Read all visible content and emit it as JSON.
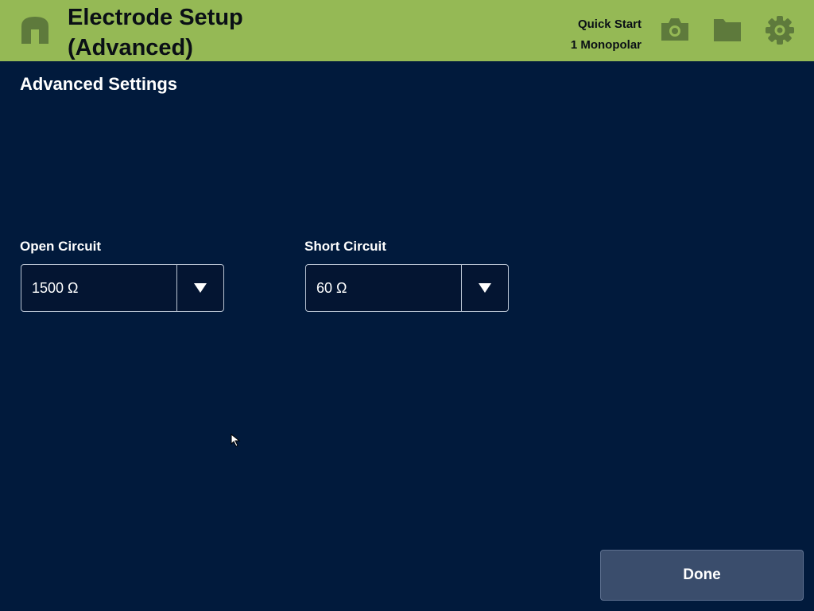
{
  "header": {
    "title_line1": "Electrode Setup",
    "title_line2": "(Advanced)",
    "preset_name": "Quick Start",
    "preset_mode": "1 Monopolar",
    "icons": [
      "home-icon",
      "camera-icon",
      "folder-icon",
      "gear-icon"
    ]
  },
  "main": {
    "section_title": "Advanced Settings",
    "open_circuit": {
      "label": "Open Circuit",
      "value": "1500 Ω"
    },
    "short_circuit": {
      "label": "Short Circuit",
      "value": "60 Ω"
    }
  },
  "footer": {
    "done_label": "Done"
  },
  "colors": {
    "header_bg": "#95b955",
    "icon_color": "#5e7a3c",
    "background": "#011a3c",
    "done_button": "#3a4d6c"
  }
}
